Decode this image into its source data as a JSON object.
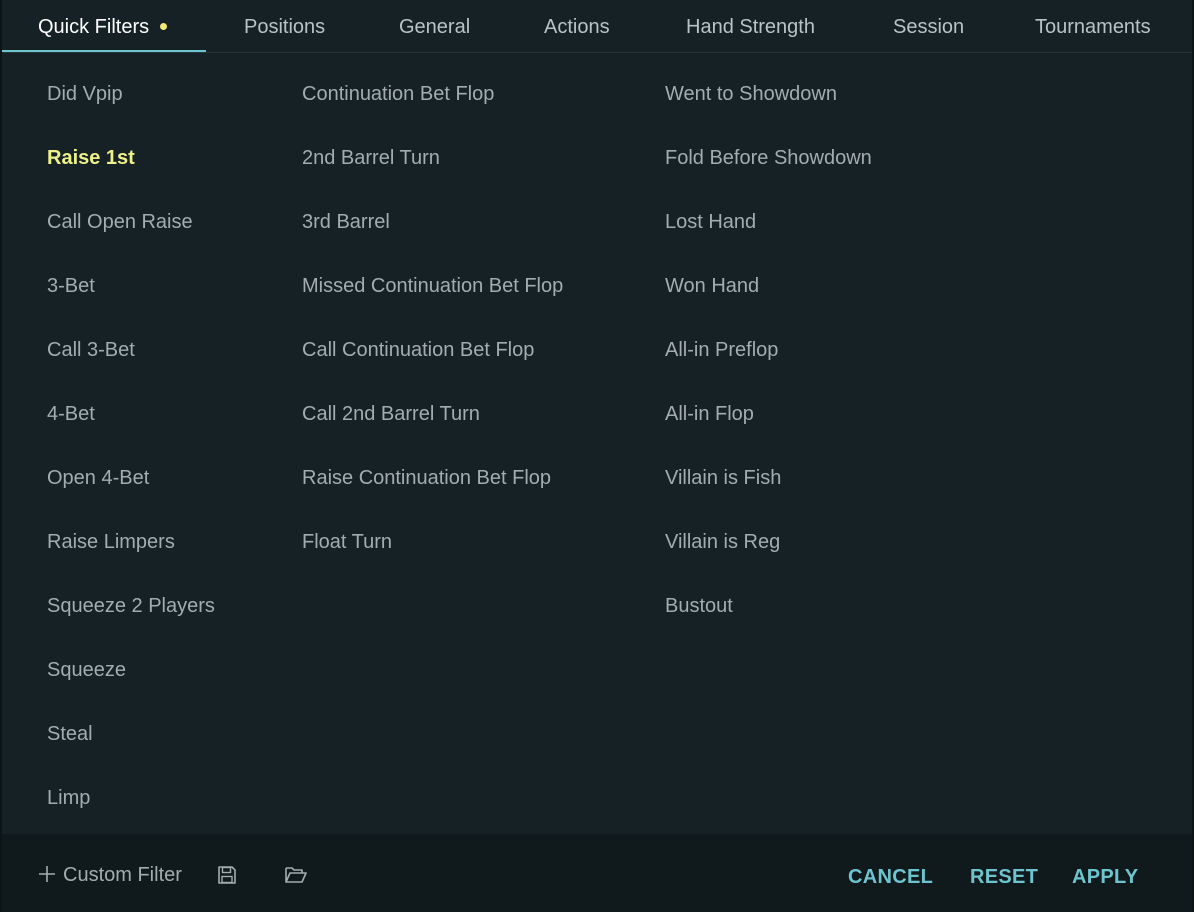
{
  "colors": {
    "accent": "#6ec4ce",
    "selected_item": "#eef08a",
    "modified_dot": "#f2e977"
  },
  "tabs": [
    {
      "label": "Quick Filters",
      "active": true,
      "modified": true
    },
    {
      "label": "Positions"
    },
    {
      "label": "General"
    },
    {
      "label": "Actions"
    },
    {
      "label": "Hand Strength"
    },
    {
      "label": "Session"
    },
    {
      "label": "Tournaments"
    }
  ],
  "columns": {
    "preflop": [
      {
        "label": "Did Vpip"
      },
      {
        "label": "Raise 1st",
        "selected": true
      },
      {
        "label": "Call Open Raise"
      },
      {
        "label": "3-Bet"
      },
      {
        "label": "Call 3-Bet"
      },
      {
        "label": "4-Bet"
      },
      {
        "label": "Open 4-Bet"
      },
      {
        "label": "Raise Limpers"
      },
      {
        "label": "Squeeze 2 Players"
      },
      {
        "label": "Squeeze"
      },
      {
        "label": "Steal"
      },
      {
        "label": "Limp"
      }
    ],
    "postflop": [
      {
        "label": "Continuation Bet Flop"
      },
      {
        "label": "2nd Barrel Turn"
      },
      {
        "label": "3rd Barrel"
      },
      {
        "label": "Missed Continuation Bet Flop"
      },
      {
        "label": "Call Continuation Bet Flop"
      },
      {
        "label": "Call 2nd Barrel Turn"
      },
      {
        "label": "Raise Continuation Bet Flop"
      },
      {
        "label": "Float Turn"
      }
    ],
    "outcome": [
      {
        "label": "Went to Showdown"
      },
      {
        "label": "Fold Before Showdown"
      },
      {
        "label": "Lost Hand"
      },
      {
        "label": "Won Hand"
      },
      {
        "label": "All-in Preflop"
      },
      {
        "label": "All-in Flop"
      },
      {
        "label": "Villain is Fish"
      },
      {
        "label": "Villain is Reg"
      },
      {
        "label": "Bustout"
      }
    ]
  },
  "footer": {
    "add_filter_label": "Custom Filter",
    "add_filter_icon": "plus-icon",
    "save_icon": "save-icon",
    "open_icon": "folder-open-icon",
    "cancel_label": "CANCEL",
    "reset_label": "RESET",
    "apply_label": "APPLY"
  }
}
